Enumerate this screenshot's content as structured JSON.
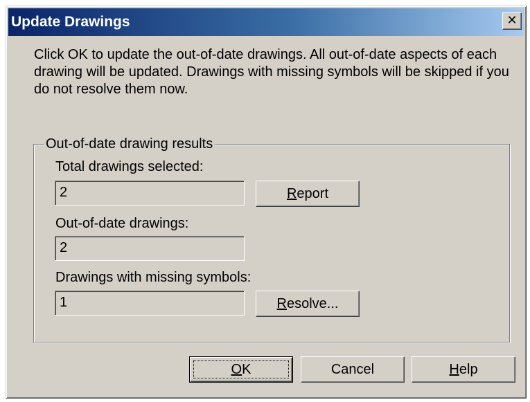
{
  "window": {
    "title": "Update Drawings",
    "close_glyph": "✕",
    "close_icon": "close-icon"
  },
  "message": "Click OK to update the out-of-date drawings. All out-of-date aspects of each drawing will be updated. Drawings with missing symbols will be skipped if you do not resolve them now.",
  "group": {
    "legend": "Out-of-date drawing results",
    "fields": [
      {
        "label": "Total drawings selected:",
        "value": "2"
      },
      {
        "label": "Out-of-date drawings:",
        "value": "2"
      },
      {
        "label": "Drawings with missing symbols:",
        "value": "1"
      }
    ],
    "report_button": {
      "accel": "R",
      "rest": "eport"
    },
    "resolve_button": {
      "accel": "R",
      "rest": "esolve..."
    }
  },
  "buttons": {
    "ok": {
      "accel": "O",
      "rest": "K"
    },
    "cancel": {
      "label": "Cancel"
    },
    "help": {
      "accel": "H",
      "rest": "elp"
    }
  },
  "colors": {
    "dialog_face": "#d4d0c8",
    "titlebar_start": "#0a246a",
    "titlebar_end": "#a6caf0",
    "title_text": "#ffffff"
  }
}
